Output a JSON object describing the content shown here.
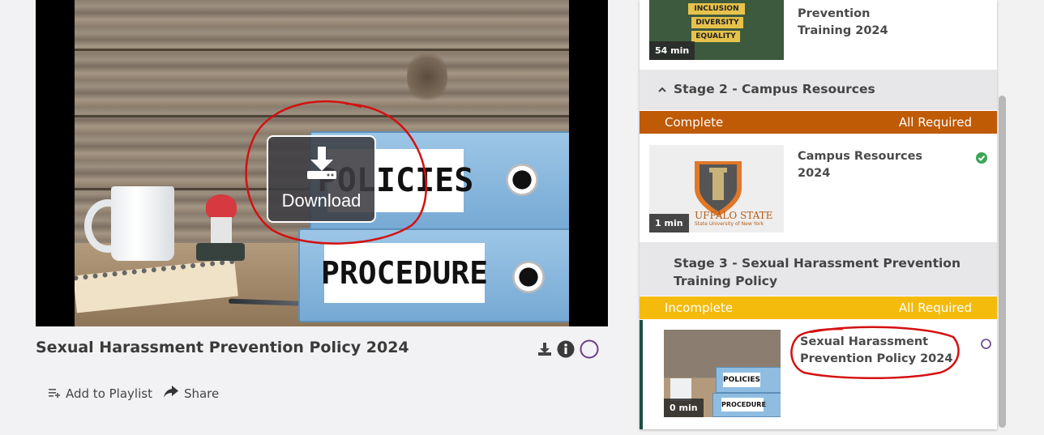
{
  "player": {
    "overlay": {
      "label": "Download",
      "icon": "download-icon"
    },
    "thumbnail_text": {
      "binder_top": "POLICIES",
      "binder_bottom": "PROCEDURE"
    }
  },
  "video": {
    "title": "Sexual Harassment Prevention Policy 2024",
    "icons": [
      "download-icon",
      "info-icon",
      "completion-circle-icon"
    ]
  },
  "actions": {
    "add_to_playlist": "Add to Playlist",
    "share": "Share"
  },
  "panel": {
    "items_top": {
      "title_line1": "Harassment Prevention",
      "title_line2": "Training 2024",
      "thumb_words": [
        "INCLUSION",
        "DIVERSITY",
        "EQUALITY"
      ],
      "duration": "54 min"
    },
    "stage2": {
      "title": "Stage 2 - Campus Resources",
      "status": "Complete",
      "requirement": "All Required",
      "status_color": "#bf5a05",
      "item": {
        "title": "Campus Resources 2024",
        "duration": "1 min",
        "thumb_text": "UFFALO STATE",
        "thumb_subtext": "State University of New York"
      }
    },
    "stage3": {
      "title_line1": "Stage 3 - Sexual Harassment Prevention",
      "title_line2": "Training Policy",
      "status": "Incomplete",
      "requirement": "All Required",
      "status_color": "#f4bb0c",
      "item": {
        "title_line1": "Sexual Harassment",
        "title_line2": "Prevention Policy 2024",
        "duration": "0 min",
        "thumb_text": [
          "POLICIES",
          "PROCEDURE"
        ]
      }
    }
  },
  "colors": {
    "complete_check": "#3aa655",
    "incomplete_circle": "#6a3d8a",
    "annotation": "#d41010"
  }
}
